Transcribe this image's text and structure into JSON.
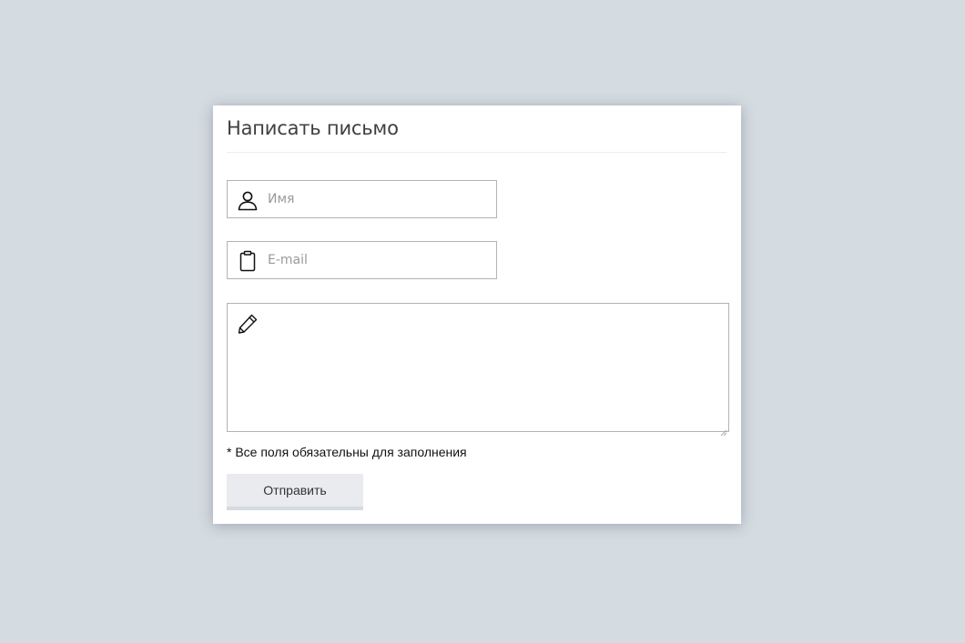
{
  "form": {
    "title": "Написать письмо",
    "name_field": {
      "placeholder": "Имя",
      "value": "",
      "icon": "user-icon"
    },
    "email_field": {
      "placeholder": "E-mail",
      "value": "",
      "icon": "clipboard-icon"
    },
    "message_field": {
      "placeholder": "",
      "value": "",
      "icon": "pencil-icon"
    },
    "required_note": "* Все поля обязательны для заполнения",
    "submit_label": "Отправить"
  },
  "colors": {
    "page_background": "#d4dbe1",
    "card_background": "#ffffff",
    "field_border": "#b3b3b3",
    "button_background": "#e9ebee",
    "title_text": "#3f3f3f"
  }
}
